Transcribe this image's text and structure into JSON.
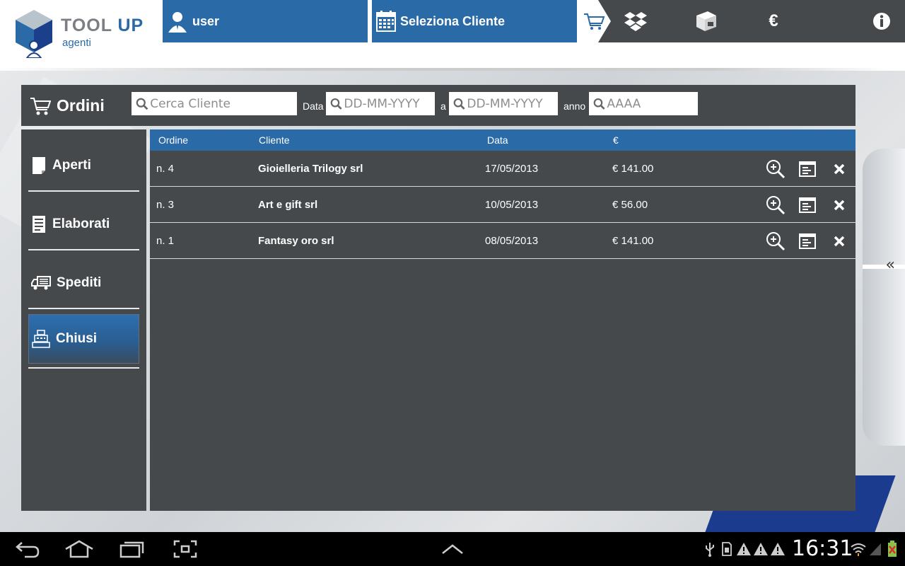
{
  "app": {
    "brand_main": "TOOL ",
    "brand_accent": "UP",
    "brand_sub": "agenti"
  },
  "topbar": {
    "user_label": "user",
    "client_label": "Seleziona Cliente",
    "currency_symbol": "€",
    "icons": [
      "user-icon",
      "calendar-icon",
      "cart-icon",
      "dropbox-icon",
      "box-icon",
      "euro-icon",
      "info-icon"
    ]
  },
  "orders": {
    "title": "Ordini",
    "search_client_placeholder": "Cerca Cliente",
    "date_label": "Data",
    "date_from_placeholder": "DD-MM-YYYY",
    "to_label": "a",
    "date_to_placeholder": "DD-MM-YYYY",
    "year_label": "anno",
    "year_placeholder": "AAAA"
  },
  "sidebar": {
    "items": [
      {
        "label": "Aperti",
        "icon": "document-icon",
        "active": false
      },
      {
        "label": "Elaborati",
        "icon": "list-doc-icon",
        "active": false
      },
      {
        "label": "Spediti",
        "icon": "truck-icon",
        "active": false
      },
      {
        "label": "Chiusi",
        "icon": "register-icon",
        "active": true
      }
    ]
  },
  "table": {
    "headers": {
      "order": "Ordine",
      "client": "Cliente",
      "date": "Data",
      "amount": "€"
    },
    "rows": [
      {
        "order": "n. 4",
        "client": "Gioielleria Trilogy srl",
        "date": "17/05/2013",
        "amount": "€ 141.00"
      },
      {
        "order": "n. 3",
        "client": "Art e gift srl",
        "date": "10/05/2013",
        "amount": "€ 56.00"
      },
      {
        "order": "n. 1",
        "client": "Fantasy oro srl",
        "date": "08/05/2013",
        "amount": "€ 141.00"
      }
    ]
  },
  "statusbar": {
    "time": "16:31"
  },
  "colors": {
    "accent": "#2a6aa6",
    "panel": "#45494c"
  }
}
